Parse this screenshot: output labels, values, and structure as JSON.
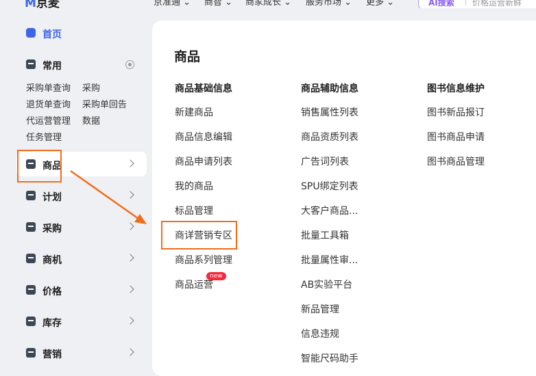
{
  "topbar": {
    "logo_mark": "M",
    "logo_text": "京麦",
    "nav": [
      "京准通 ⌄",
      "商智 ⌄",
      "商家成长 ⌄",
      "服务市场 ⌄",
      "更多 ⌄"
    ],
    "ai_search_label": "AI搜索",
    "search_placeholder": "价格运营新鲜"
  },
  "sidebar": {
    "home": "首页",
    "common": "常用",
    "common_links": [
      "采购单查询",
      "采购",
      "退货单查询",
      "采购单回告",
      "代运营管理",
      "数据",
      "任务管理"
    ],
    "items": [
      "商品",
      "计划",
      "采购",
      "商机",
      "价格",
      "库存",
      "营销"
    ]
  },
  "panel": {
    "title": "商品",
    "columns": [
      {
        "header": "商品基础信息",
        "links": [
          "新建商品",
          "商品信息编辑",
          "商品申请列表",
          "我的商品",
          "标品管理",
          "商详营销专区",
          "商品系列管理",
          "商品运营"
        ]
      },
      {
        "header": "商品辅助信息",
        "links": [
          "销售属性列表",
          "商品资质列表",
          "广告词列表",
          "SPU绑定列表",
          "大客户商品...",
          "批量工具箱",
          "批量属性审...",
          "AB实验平台",
          "新品管理",
          "信息违规",
          "智能尺码助手"
        ]
      },
      {
        "header": "图书信息维护",
        "links": [
          "图书新品报订",
          "图书商品申请",
          "图书商品管理"
        ]
      }
    ],
    "new_badge": "new"
  },
  "colors": {
    "accent": "#3e64e8",
    "annotation": "#f06d1b",
    "badge": "#f5283c"
  }
}
